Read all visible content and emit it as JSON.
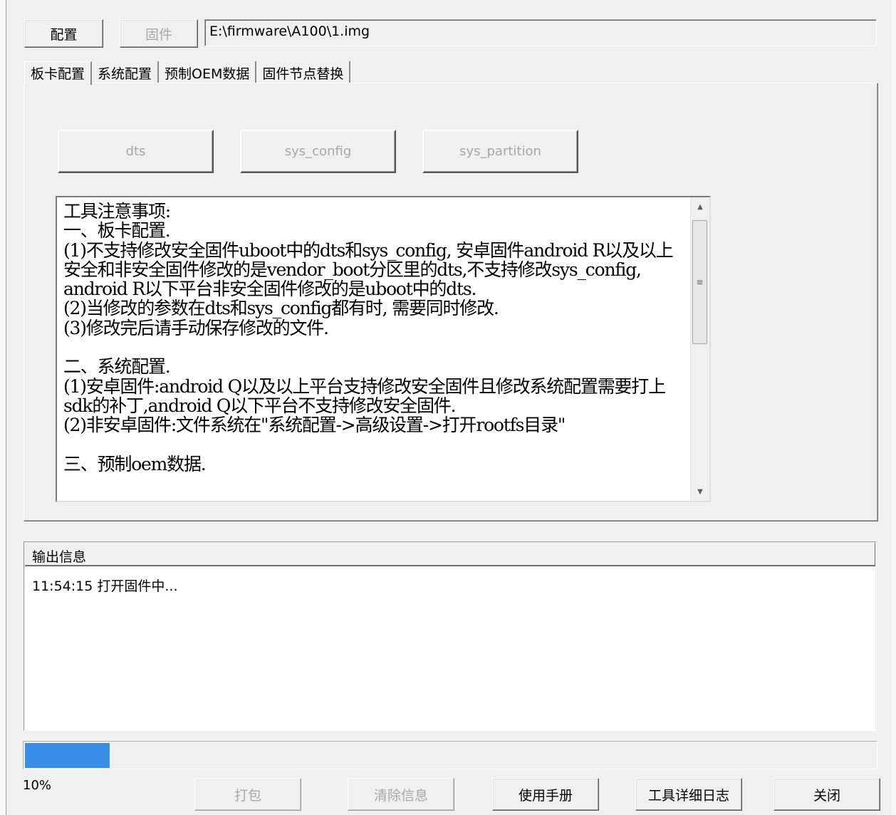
{
  "toolbar": {
    "config_label": "配置",
    "firmware_label": "固件",
    "firmware_path": "E:\\firmware\\A100\\1.img"
  },
  "tabs": [
    {
      "label": "板卡配置",
      "active": true
    },
    {
      "label": "系统配置",
      "active": false
    },
    {
      "label": "预制OEM数据",
      "active": false
    },
    {
      "label": "固件节点替换",
      "active": false
    }
  ],
  "board": {
    "dts_label": "dts",
    "sys_config_label": "sys_config",
    "sys_partition_label": "sys_partition",
    "notes": "工具注意事项:\n一、板卡配置.\n(1)不支持修改安全固件uboot中的dts和sys_config, 安卓固件android R以及以上安全和非安全固件修改的是vendor_boot分区里的dts,不支持修改sys_config, android R以下平台非安全固件修改的是uboot中的dts.\n(2)当修改的参数在dts和sys_config都有时, 需要同时修改.\n(3)修改完后请手动保存修改的文件.\n\n二、系统配置.\n(1)安卓固件:android Q以及以上平台支持修改安全固件且修改系统配置需要打上sdk的补丁,android Q以下平台不支持修改安全固件.\n(2)非安卓固件:文件系统在\"系统配置->高级设置->打开rootfs目录\"\n\n三、预制oem数据."
  },
  "output": {
    "header": "输出信息",
    "lines": [
      "11:54:15  打开固件中..."
    ]
  },
  "progress": {
    "value": 0.1,
    "label": "10%",
    "color": "#3a8ee6"
  },
  "bottom_buttons": {
    "pack_label": "打包",
    "clear_label": "清除信息",
    "manual_label": "使用手册",
    "log_label": "工具详细日志",
    "close_label": "关闭"
  }
}
